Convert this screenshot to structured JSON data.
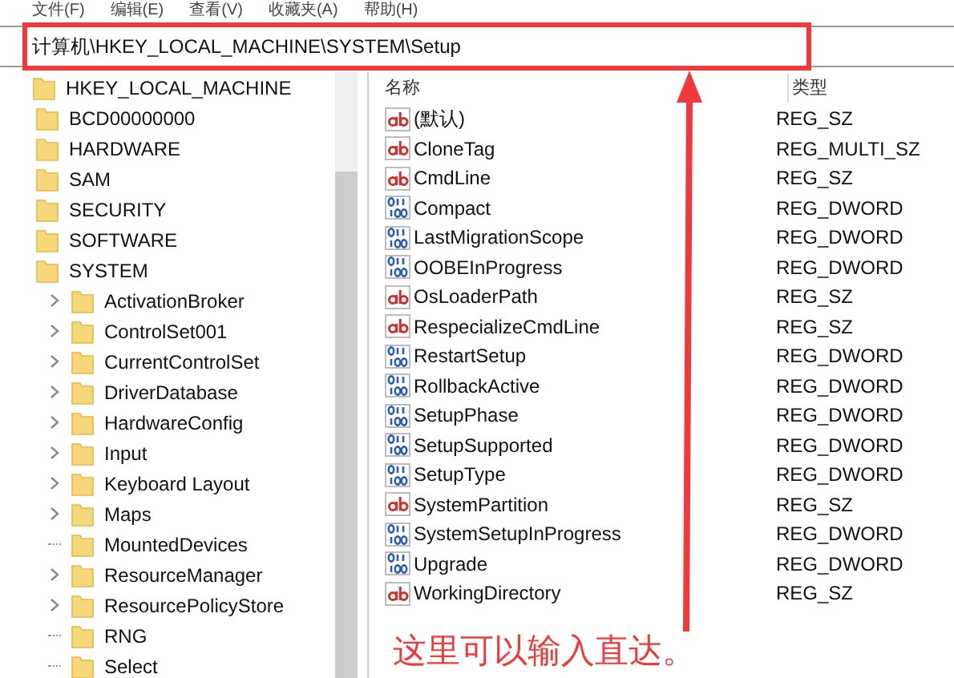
{
  "menu": [
    "文件(F)",
    "编辑(E)",
    "查看(V)",
    "收藏夹(A)",
    "帮助(H)"
  ],
  "address": "计算机\\HKEY_LOCAL_MACHINE\\SYSTEM\\Setup",
  "tree": {
    "label": "HKEY_LOCAL_MACHINE",
    "children": [
      {
        "label": "BCD00000000"
      },
      {
        "label": "HARDWARE"
      },
      {
        "label": "SAM"
      },
      {
        "label": "SECURITY"
      },
      {
        "label": "SOFTWARE"
      },
      {
        "label": "SYSTEM",
        "children": [
          {
            "label": "ActivationBroker",
            "expandable": true
          },
          {
            "label": "ControlSet001",
            "expandable": true
          },
          {
            "label": "CurrentControlSet",
            "expandable": true
          },
          {
            "label": "DriverDatabase",
            "expandable": true
          },
          {
            "label": "HardwareConfig",
            "expandable": true
          },
          {
            "label": "Input",
            "expandable": true
          },
          {
            "label": "Keyboard Layout",
            "expandable": true
          },
          {
            "label": "Maps",
            "expandable": true
          },
          {
            "label": "MountedDevices",
            "expandable": false
          },
          {
            "label": "ResourceManager",
            "expandable": true
          },
          {
            "label": "ResourcePolicyStore",
            "expandable": true
          },
          {
            "label": "RNG",
            "expandable": false
          },
          {
            "label": "Select",
            "expandable": false
          }
        ]
      }
    ]
  },
  "columns": [
    "名称",
    "类型"
  ],
  "values": [
    {
      "name": "(默认)",
      "type": "REG_SZ",
      "kind": "string"
    },
    {
      "name": "CloneTag",
      "type": "REG_MULTI_SZ",
      "kind": "string"
    },
    {
      "name": "CmdLine",
      "type": "REG_SZ",
      "kind": "string"
    },
    {
      "name": "Compact",
      "type": "REG_DWORD",
      "kind": "binary"
    },
    {
      "name": "LastMigrationScope",
      "type": "REG_DWORD",
      "kind": "binary"
    },
    {
      "name": "OOBEInProgress",
      "type": "REG_DWORD",
      "kind": "binary"
    },
    {
      "name": "OsLoaderPath",
      "type": "REG_SZ",
      "kind": "string"
    },
    {
      "name": "RespecializeCmdLine",
      "type": "REG_SZ",
      "kind": "string"
    },
    {
      "name": "RestartSetup",
      "type": "REG_DWORD",
      "kind": "binary"
    },
    {
      "name": "RollbackActive",
      "type": "REG_DWORD",
      "kind": "binary"
    },
    {
      "name": "SetupPhase",
      "type": "REG_DWORD",
      "kind": "binary"
    },
    {
      "name": "SetupSupported",
      "type": "REG_DWORD",
      "kind": "binary"
    },
    {
      "name": "SetupType",
      "type": "REG_DWORD",
      "kind": "binary"
    },
    {
      "name": "SystemPartition",
      "type": "REG_SZ",
      "kind": "string"
    },
    {
      "name": "SystemSetupInProgress",
      "type": "REG_DWORD",
      "kind": "binary"
    },
    {
      "name": "Upgrade",
      "type": "REG_DWORD",
      "kind": "binary"
    },
    {
      "name": "WorkingDirectory",
      "type": "REG_SZ",
      "kind": "string"
    }
  ],
  "annotation": {
    "text": "这里可以输入直达。"
  }
}
